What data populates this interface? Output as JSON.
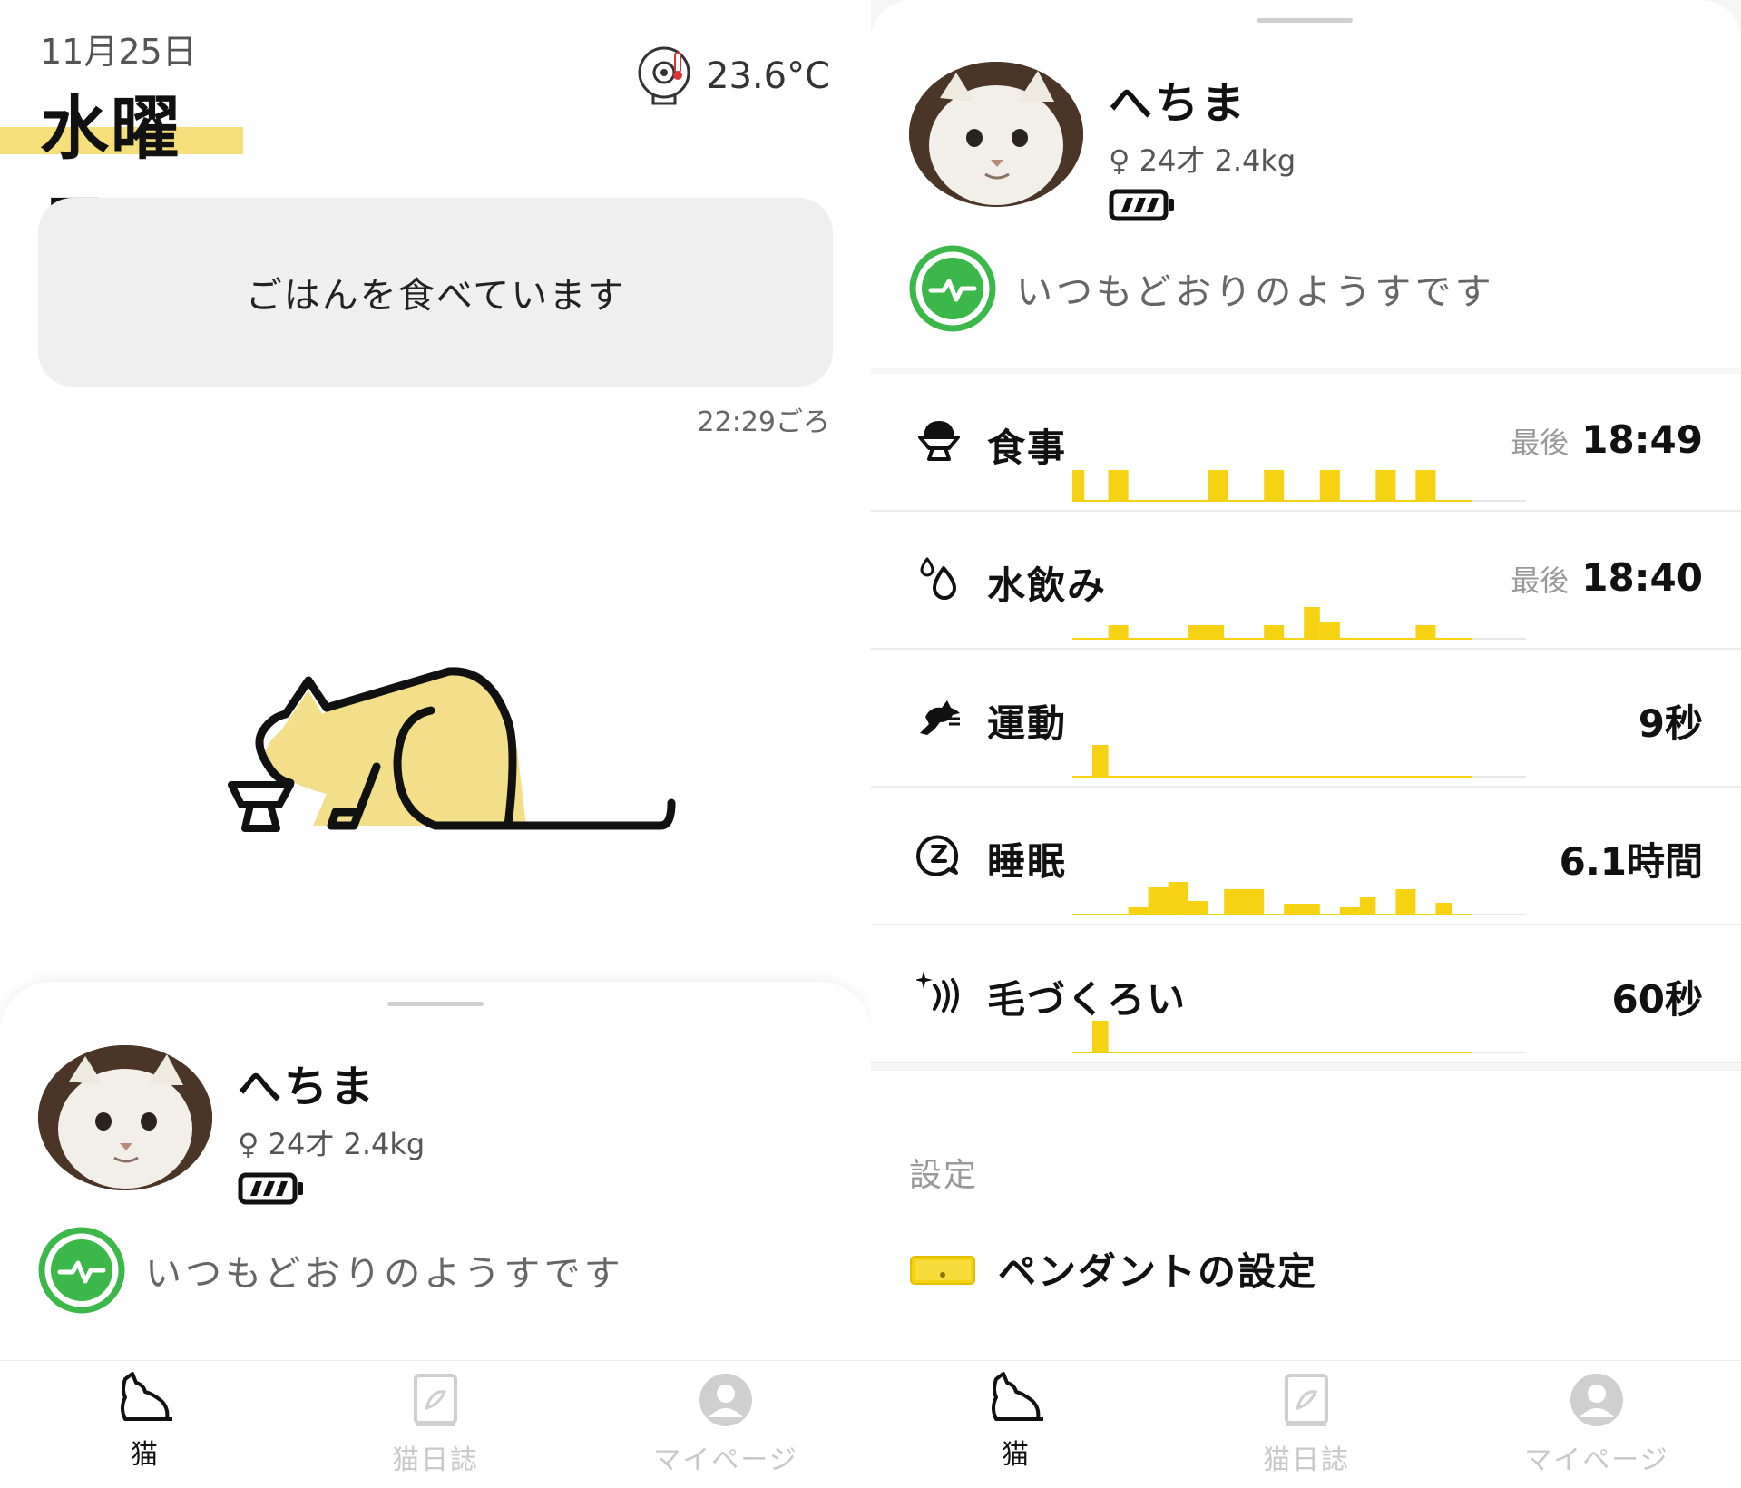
{
  "left": {
    "date": "11月25日",
    "weekday": "水曜日",
    "temperature": "23.6°C",
    "status_message": "ごはんを食べています",
    "status_time": "22:29ごろ",
    "profile": {
      "name": "へちま",
      "meta": "♀ 24才 2.4kg"
    },
    "health_text": "いつもどおりのようすです"
  },
  "right": {
    "profile": {
      "name": "へちま",
      "meta": "♀ 24才 2.4kg"
    },
    "health_text": "いつもどおりのようすです",
    "metrics": [
      {
        "label": "食事",
        "prefix": "最後",
        "value": "18:49",
        "icon": "bowl-icon",
        "bars": [
          [
            0,
            0.03,
            0.68
          ],
          [
            0.09,
            0.14,
            0.68
          ],
          [
            0.34,
            0.39,
            0.68
          ],
          [
            0.48,
            0.53,
            0.68
          ],
          [
            0.62,
            0.67,
            0.68
          ],
          [
            0.76,
            0.81,
            0.68
          ],
          [
            0.86,
            0.91,
            0.68
          ]
        ]
      },
      {
        "label": "水飲み",
        "prefix": "最後",
        "value": "18:40",
        "icon": "water-drop-icon",
        "bars": [
          [
            0.09,
            0.14,
            0.3
          ],
          [
            0.29,
            0.38,
            0.3
          ],
          [
            0.48,
            0.53,
            0.3
          ],
          [
            0.58,
            0.62,
            0.7
          ],
          [
            0.62,
            0.67,
            0.36
          ],
          [
            0.86,
            0.91,
            0.3
          ]
        ]
      },
      {
        "label": "運動",
        "prefix": "",
        "value": "9秒",
        "icon": "running-cat-icon",
        "bars": [
          [
            0.05,
            0.09,
            0.7
          ]
        ]
      },
      {
        "label": "睡眠",
        "prefix": "",
        "value": "6.1時間",
        "icon": "sleep-icon",
        "bars": [
          [
            0.14,
            0.19,
            0.16
          ],
          [
            0.19,
            0.24,
            0.6
          ],
          [
            0.24,
            0.29,
            0.72
          ],
          [
            0.29,
            0.34,
            0.3
          ],
          [
            0.38,
            0.48,
            0.56
          ],
          [
            0.53,
            0.62,
            0.24
          ],
          [
            0.67,
            0.72,
            0.16
          ],
          [
            0.72,
            0.76,
            0.38
          ],
          [
            0.81,
            0.86,
            0.56
          ],
          [
            0.91,
            0.95,
            0.26
          ]
        ]
      },
      {
        "label": "毛づくろい",
        "prefix": "",
        "value": "60秒",
        "icon": "grooming-icon",
        "bars": [
          [
            0.05,
            0.09,
            0.7
          ]
        ]
      }
    ],
    "settings_header": "設定",
    "pendant_label": "ペンダントの設定"
  },
  "nav": [
    {
      "label": "猫",
      "icon": "cat-icon",
      "active": true
    },
    {
      "label": "猫日誌",
      "icon": "diary-icon",
      "active": false
    },
    {
      "label": "マイページ",
      "icon": "user-icon",
      "active": false
    }
  ],
  "colors": {
    "accent": "#f5d312",
    "highlight": "#f5df7a",
    "health_green": "#3cb84a",
    "cat_fill": "#f3df8a"
  }
}
